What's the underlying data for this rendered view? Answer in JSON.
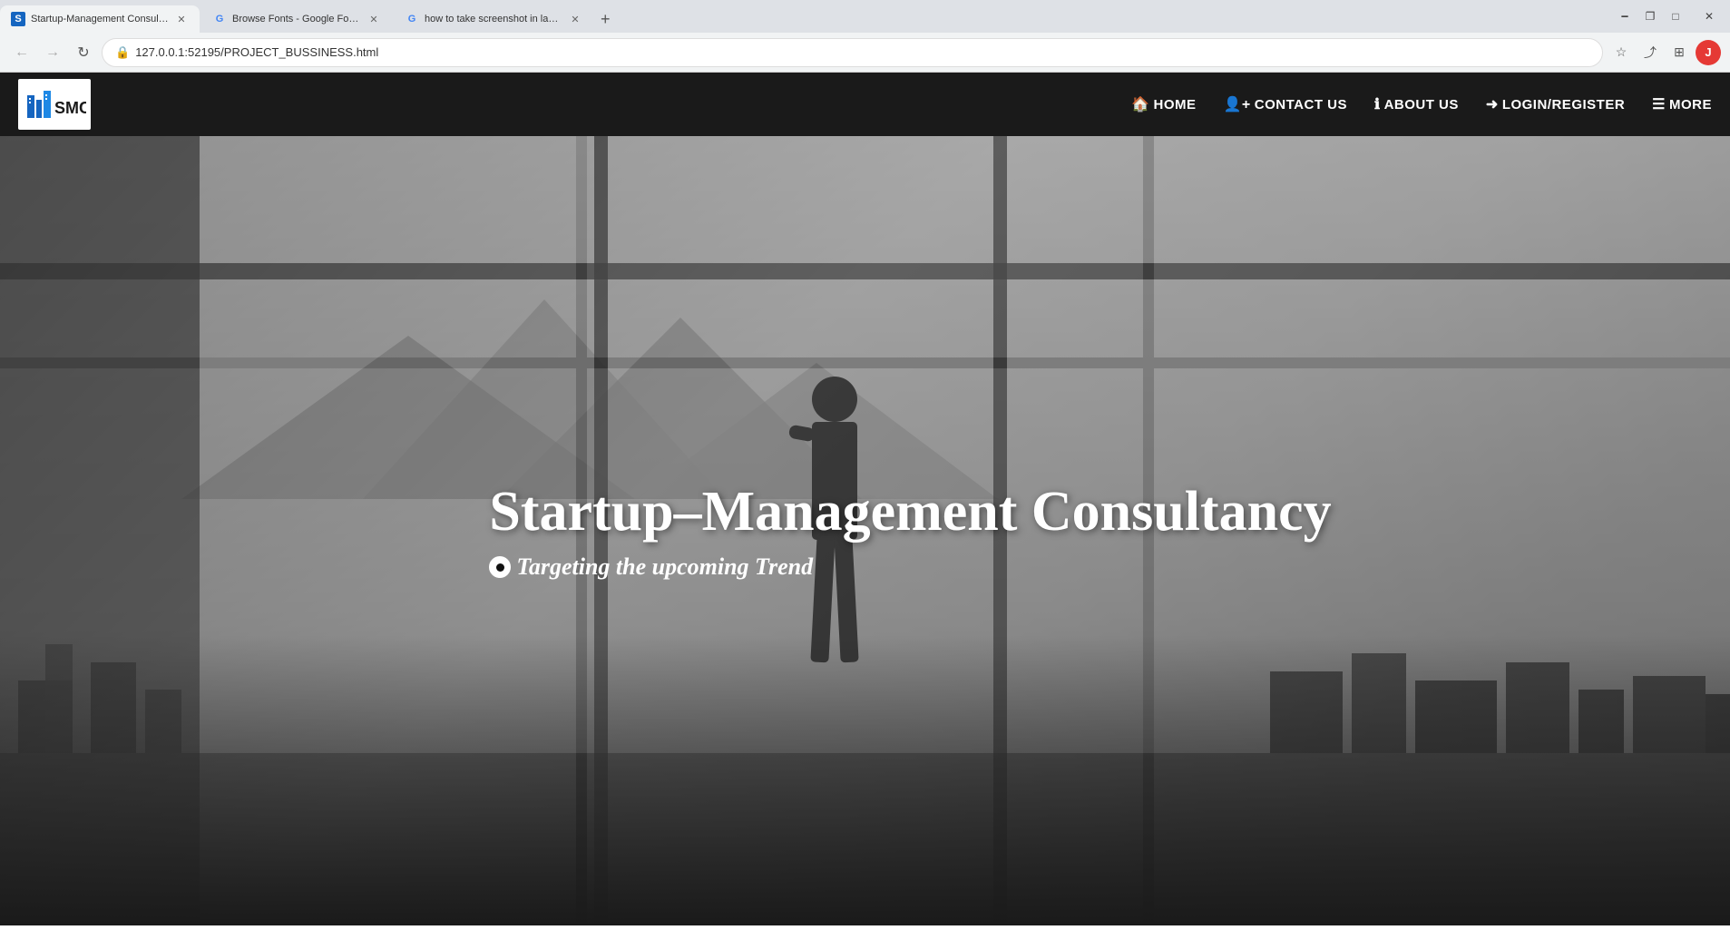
{
  "browser": {
    "tabs": [
      {
        "id": "tab1",
        "title": "Startup-Management Consultan...",
        "favicon": "SMC",
        "active": true
      },
      {
        "id": "tab2",
        "title": "Browse Fonts - Google Fonts",
        "favicon": "G",
        "active": false
      },
      {
        "id": "tab3",
        "title": "how to take screenshot in lapto...",
        "favicon": "G",
        "active": false
      }
    ],
    "address": "127.0.0.1:52195/PROJECT_BUSSINESS.html",
    "window_controls": {
      "minimize": "—",
      "maximize": "□",
      "close": "✕"
    }
  },
  "navbar": {
    "logo_text": "SMC",
    "links": [
      {
        "label": "HOME",
        "icon": "🏠"
      },
      {
        "label": "CONTACT US",
        "icon": "👤"
      },
      {
        "label": "ABOUT US",
        "icon": "ℹ"
      },
      {
        "label": "LOGIN/REGISTER",
        "icon": "→"
      },
      {
        "label": "MORE",
        "icon": "☰"
      }
    ]
  },
  "hero": {
    "title": "Startup–Management Consultancy",
    "subtitle": "Targeting the upcoming Trend"
  }
}
